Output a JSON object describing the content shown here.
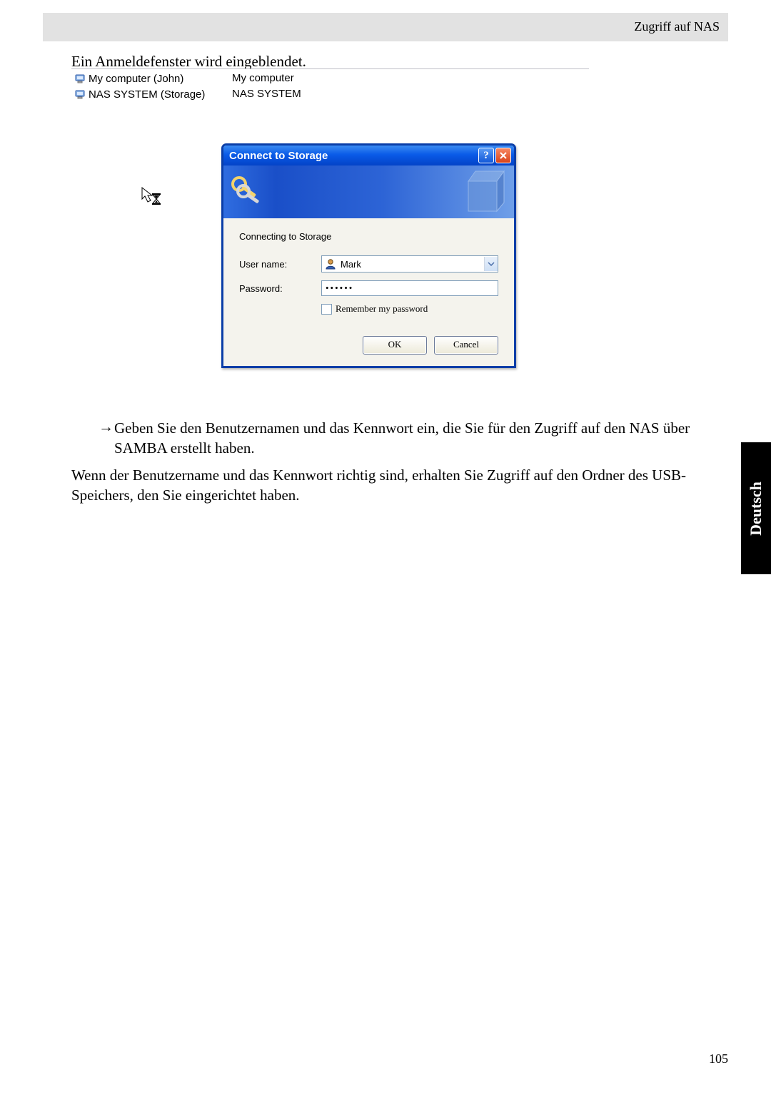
{
  "header": {
    "title": "Zugriff auf NAS"
  },
  "intro_line": "Ein Anmeldefenster wird eingeblendet.",
  "tree": {
    "item1": {
      "label": "My computer (John)",
      "detail": "My computer"
    },
    "item2": {
      "label": "NAS SYSTEM (Storage)",
      "detail": "NAS SYSTEM"
    }
  },
  "dialog": {
    "title": "Connect to Storage",
    "connecting_text": "Connecting to Storage",
    "username_label": "User name:",
    "username_value": "Mark",
    "password_label": "Password:",
    "password_value": "••••••",
    "remember_label": "Remember my password",
    "ok_label": "OK",
    "cancel_label": "Cancel"
  },
  "body_text": {
    "arrow": "→",
    "p1": "Geben Sie den Benutzernamen und das Kennwort ein, die Sie für den Zugriff auf den NAS über SAMBA erstellt haben.",
    "p2": "Wenn der Benutzername und das Kennwort richtig sind, erhalten Sie Zugriff auf den Ordner des USB-Speichers, den Sie eingerichtet haben."
  },
  "language_tab": "Deutsch",
  "page_number": "105"
}
